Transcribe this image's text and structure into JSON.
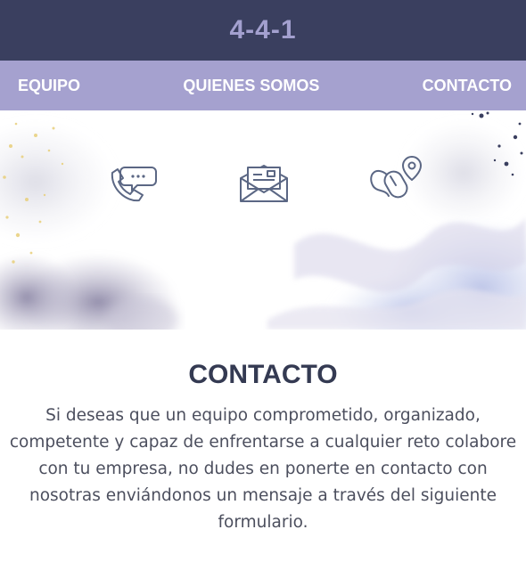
{
  "header": {
    "brand": "4-4-1"
  },
  "nav": {
    "items": [
      {
        "label": "EQUIPO"
      },
      {
        "label": "QUIENES SOMOS"
      },
      {
        "label": "CONTACTO"
      }
    ]
  },
  "hero": {
    "icons": [
      "phone-chat-icon",
      "envelope-icon",
      "mouse-location-icon"
    ]
  },
  "contact": {
    "title": "CONTACTO",
    "text": "Si deseas que un equipo comprometido, organizado, competente y capaz de enfrentarse a cualquier reto colabore con tu empresa, no dudes en ponerte en contacto con nosotras enviándonos un mensaje a través del siguiente formulario."
  },
  "colors": {
    "topbar": "#3a3f5f",
    "navbar": "#a5a1cf",
    "brand": "#a3a0cf",
    "title": "#343a52"
  }
}
